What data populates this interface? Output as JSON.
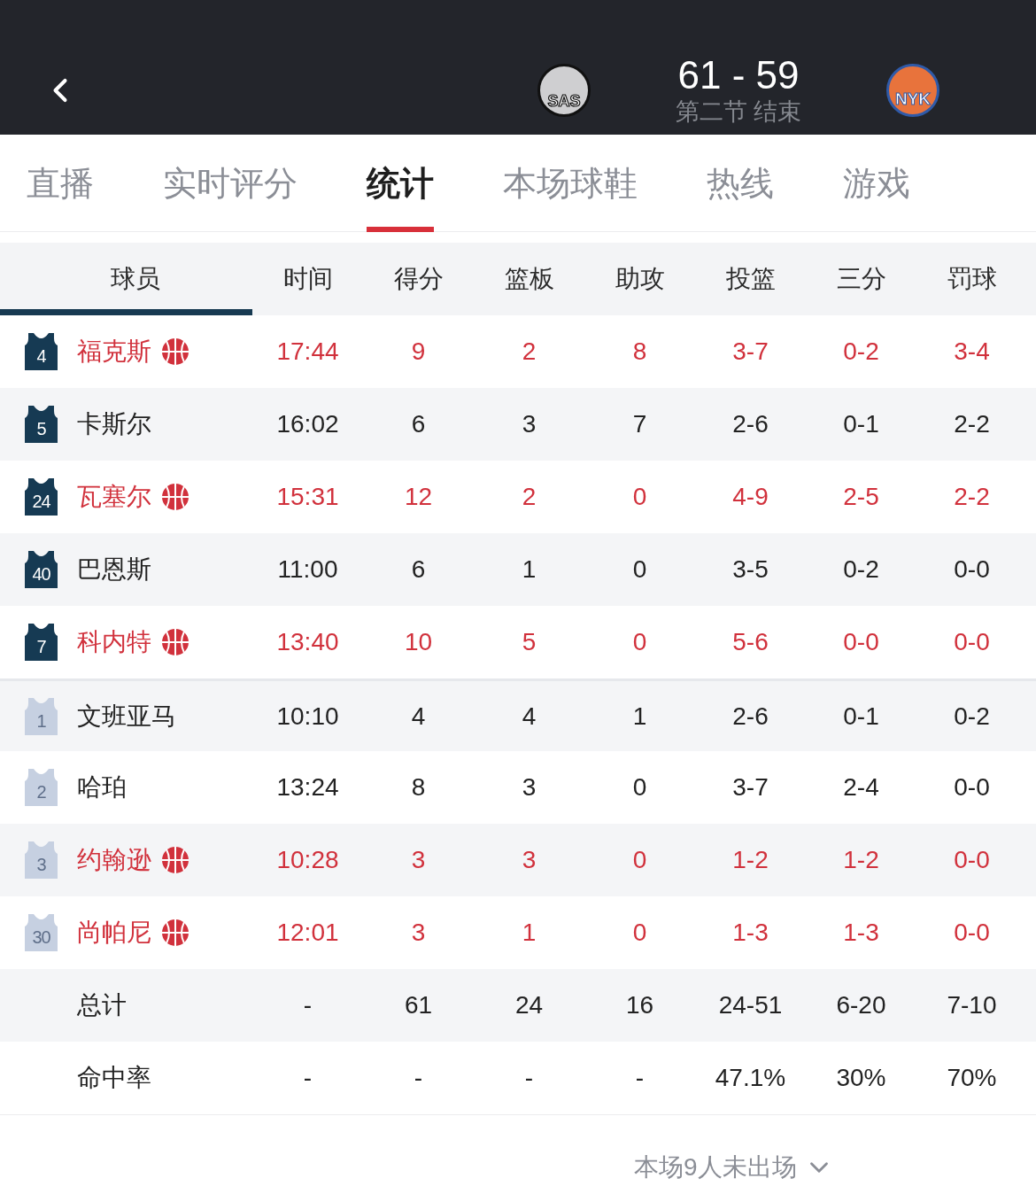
{
  "header": {
    "home_team": {
      "logo_text": "SAS"
    },
    "score": "61 - 59",
    "status": "第二节 结束",
    "away_team": {
      "logo_text": "NYK"
    }
  },
  "tabs": [
    {
      "label": "直播",
      "selected": false
    },
    {
      "label": "实时评分",
      "selected": false
    },
    {
      "label": "统计",
      "selected": true
    },
    {
      "label": "本场球鞋",
      "selected": false
    },
    {
      "label": "热线",
      "selected": false
    },
    {
      "label": "游戏",
      "selected": false
    }
  ],
  "table": {
    "columns": [
      {
        "label": "球员",
        "selected": true
      },
      {
        "label": "时间",
        "selected": false
      },
      {
        "label": "得分",
        "selected": false
      },
      {
        "label": "篮板",
        "selected": false
      },
      {
        "label": "助攻",
        "selected": false
      },
      {
        "label": "投篮",
        "selected": false
      },
      {
        "label": "三分",
        "selected": false
      },
      {
        "label": "罚球",
        "selected": false
      }
    ],
    "rows": [
      {
        "number": "4",
        "name": "福克斯",
        "starter": true,
        "on_court": true,
        "stats": [
          "17:44",
          "9",
          "2",
          "8",
          "3-7",
          "0-2",
          "3-4"
        ]
      },
      {
        "number": "5",
        "name": "卡斯尔",
        "starter": true,
        "on_court": false,
        "stats": [
          "16:02",
          "6",
          "3",
          "7",
          "2-6",
          "0-1",
          "2-2"
        ]
      },
      {
        "number": "24",
        "name": "瓦塞尔",
        "starter": true,
        "on_court": true,
        "stats": [
          "15:31",
          "12",
          "2",
          "0",
          "4-9",
          "2-5",
          "2-2"
        ]
      },
      {
        "number": "40",
        "name": "巴恩斯",
        "starter": true,
        "on_court": false,
        "stats": [
          "11:00",
          "6",
          "1",
          "0",
          "3-5",
          "0-2",
          "0-0"
        ]
      },
      {
        "number": "7",
        "name": "科内特",
        "starter": true,
        "on_court": true,
        "stats": [
          "13:40",
          "10",
          "5",
          "0",
          "5-6",
          "0-0",
          "0-0"
        ]
      },
      {
        "number": "1",
        "name": "文班亚马",
        "starter": false,
        "on_court": false,
        "stats": [
          "10:10",
          "4",
          "4",
          "1",
          "2-6",
          "0-1",
          "0-2"
        ]
      },
      {
        "number": "2",
        "name": "哈珀",
        "starter": false,
        "on_court": false,
        "stats": [
          "13:24",
          "8",
          "3",
          "0",
          "3-7",
          "2-4",
          "0-0"
        ]
      },
      {
        "number": "3",
        "name": "约翰逊",
        "starter": false,
        "on_court": true,
        "stats": [
          "10:28",
          "3",
          "3",
          "0",
          "1-2",
          "1-2",
          "0-0"
        ]
      },
      {
        "number": "30",
        "name": "尚帕尼",
        "starter": false,
        "on_court": true,
        "stats": [
          "12:01",
          "3",
          "1",
          "0",
          "1-3",
          "1-3",
          "0-0"
        ]
      }
    ],
    "summary_rows": [
      {
        "label": "总计",
        "values": [
          "-",
          "61",
          "24",
          "16",
          "24-51",
          "6-20",
          "7-10"
        ]
      },
      {
        "label": "命中率",
        "values": [
          "-",
          "-",
          "-",
          "-",
          "47.1%",
          "30%",
          "70%"
        ]
      }
    ]
  },
  "footer": {
    "label": "本场9人未出场"
  }
}
